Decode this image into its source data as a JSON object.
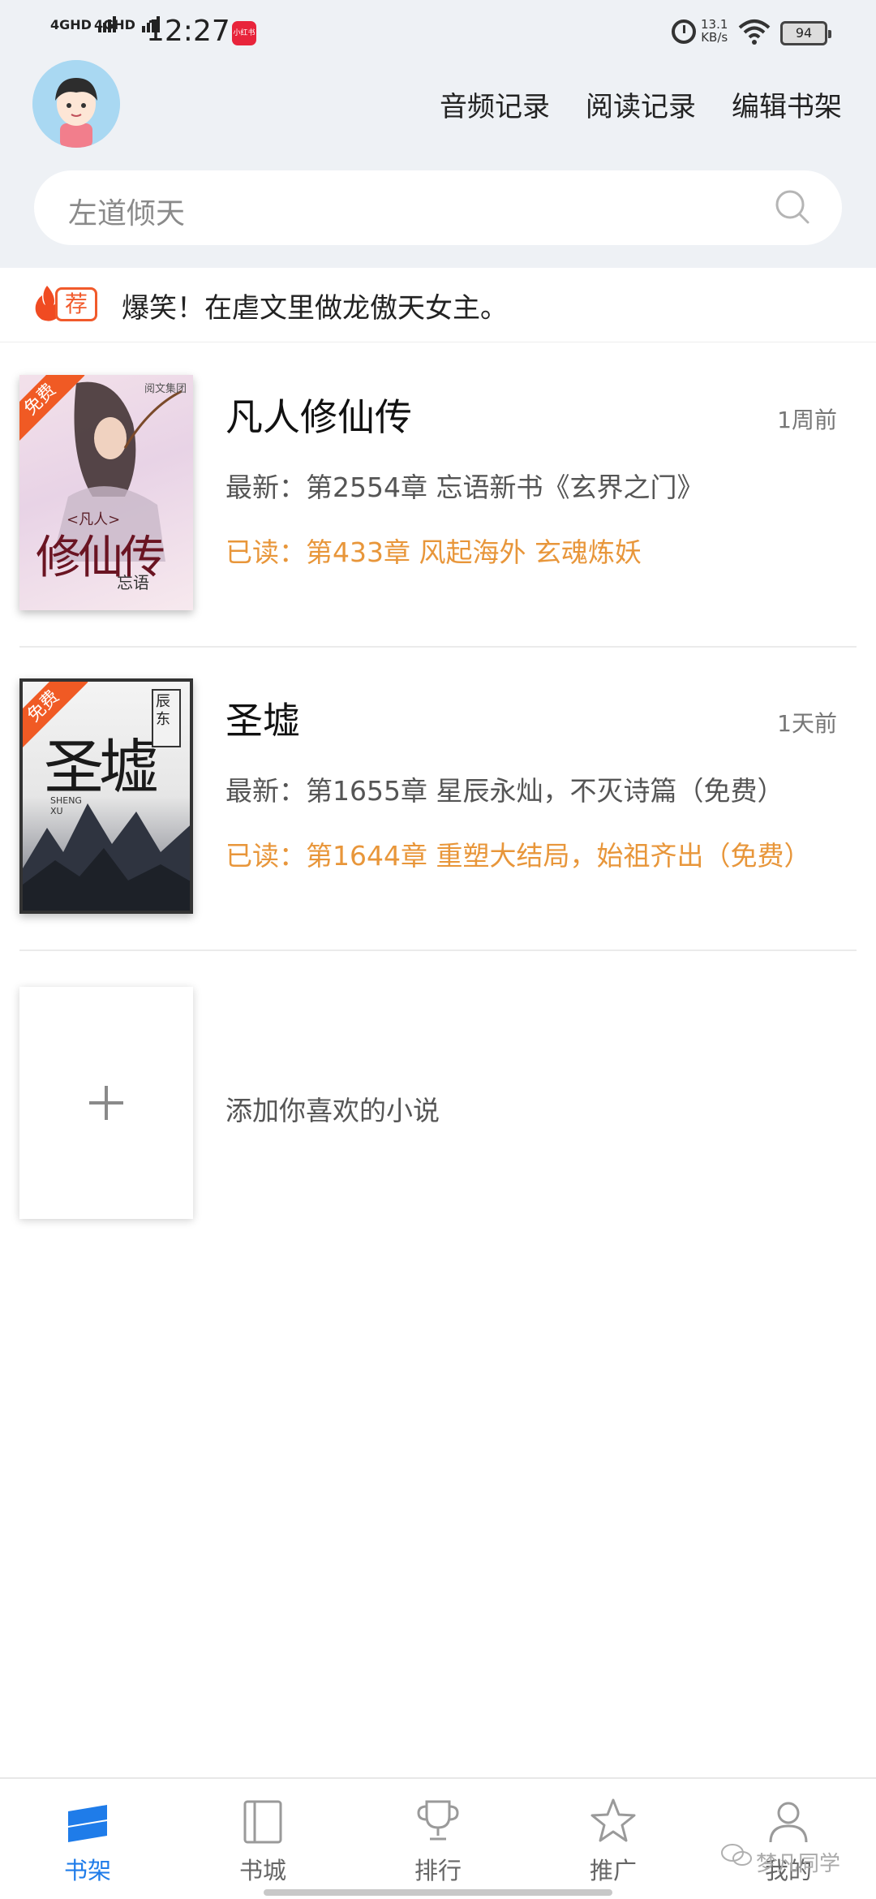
{
  "status_bar": {
    "signal_1": "4GHD",
    "signal_2": "4GHD",
    "time": "12:27",
    "notif_badge": "小红书",
    "net_speed": "13.1",
    "net_unit": "KB/s",
    "battery": "94"
  },
  "header": {
    "links": [
      "音频记录",
      "阅读记录",
      "编辑书架"
    ]
  },
  "search": {
    "placeholder": "左道倾天"
  },
  "recommend": {
    "badge": "荐",
    "text": "爆笑！在虐文里做龙傲天女主。"
  },
  "books": [
    {
      "title": "凡人修仙传",
      "time_ago": "1周前",
      "latest": "最新：第2554章 忘语新书《玄界之门》",
      "read": "已读：第433章 风起海外 玄魂炼妖",
      "ribbon": "免费",
      "cover_title": "修仙传",
      "cover_sub": "<凡人>",
      "cover_author": "忘语",
      "cover_publisher": "阅文集团"
    },
    {
      "title": "圣墟",
      "time_ago": "1天前",
      "latest": "最新：第1655章 星辰永灿，不灭诗篇（免费）",
      "read": "已读：第1644章 重塑大结局，始祖齐出（免费）",
      "ribbon": "免费",
      "cover_title": "圣墟",
      "cover_author": "辰东",
      "cover_pinyin": "SHENG XU"
    }
  ],
  "add_book": {
    "text": "添加你喜欢的小说"
  },
  "nav": {
    "tabs": [
      "书架",
      "书城",
      "排行",
      "推广",
      "我的"
    ],
    "active": "书架",
    "accent": "#1f7ce9"
  },
  "watermark": "梦凡同学"
}
